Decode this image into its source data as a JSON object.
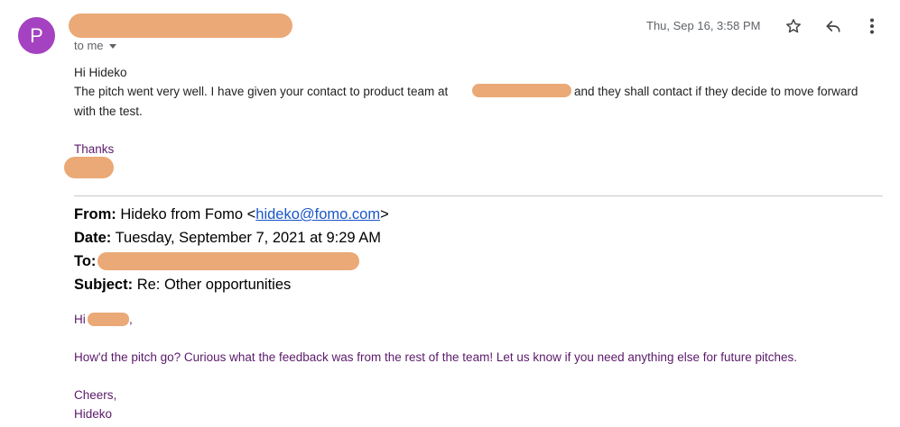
{
  "avatar": {
    "letter": "P",
    "color": "#a442c1"
  },
  "header": {
    "recipient_label": "to me",
    "timestamp": "Thu, Sep 16, 3:58 PM",
    "icons": [
      "star-icon",
      "reply-icon",
      "more-vert-icon"
    ]
  },
  "reply": {
    "greeting": "Hi Hideko",
    "line1": "The pitch went very well. I have given your contact to product team at",
    "line1_after": "and they shall contact if they decide to move forward",
    "line2": "with the test.",
    "signoff": "Thanks"
  },
  "quoted": {
    "from_label": "From:",
    "from_name": "Hideko from Fomo <",
    "from_email": "hideko@fomo.com",
    "from_close": ">",
    "date_label": "Date:",
    "date_value": "Tuesday, September 7, 2021 at 9:29 AM",
    "to_label": "To:",
    "subject_label": "Subject:",
    "subject_value": "Re: Other opportunities",
    "greeting": "Hi",
    "greeting_end": ",",
    "message": "How'd the pitch go? Curious what the feedback was from the rest of the team! Let us know if you need anything else for future pitches.",
    "closing": "Cheers,",
    "sender": "Hideko"
  },
  "colors": {
    "redaction": "#eaa976",
    "quoted_text": "#5b1a6a",
    "link": "#1a56c9"
  }
}
